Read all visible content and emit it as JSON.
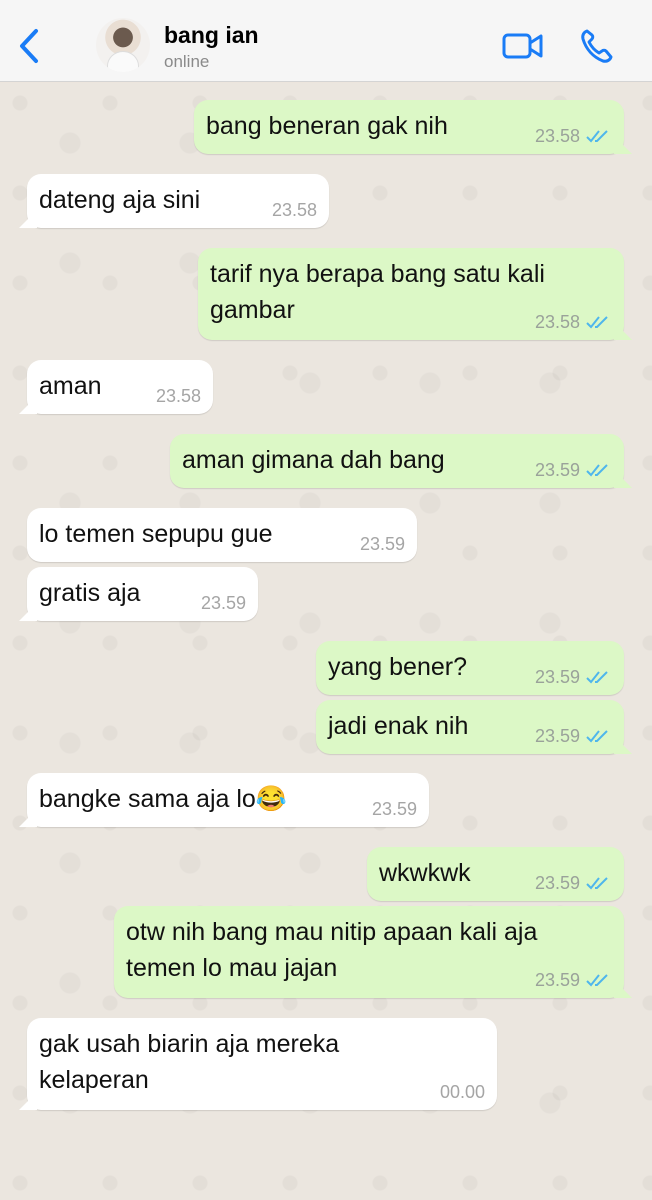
{
  "header": {
    "contact_name": "bang ian",
    "status": "online"
  },
  "colors": {
    "accent": "#1a7cf6",
    "outgoing_bubble": "#dcf8c6",
    "incoming_bubble": "#ffffff",
    "read_ticks": "#4fb6ec"
  },
  "icons": {
    "back": "chevron-left-icon",
    "video": "video-camera-icon",
    "call": "phone-icon",
    "ticks": "double-check-icon"
  },
  "messages": [
    {
      "dir": "out",
      "text": "bang beneran gak nih",
      "time": "23.58",
      "read": true
    },
    {
      "dir": "in",
      "text": "dateng aja sini",
      "time": "23.58"
    },
    {
      "dir": "out",
      "text": "tarif nya berapa bang satu kali\ngambar",
      "time": "23.58",
      "read": true
    },
    {
      "dir": "in",
      "text": "aman",
      "time": "23.58"
    },
    {
      "dir": "out",
      "text": "aman gimana dah bang",
      "time": "23.59",
      "read": true
    },
    {
      "dir": "in",
      "text": "lo temen sepupu gue",
      "time": "23.59"
    },
    {
      "dir": "in",
      "text": "gratis aja",
      "time": "23.59"
    },
    {
      "dir": "out",
      "text": "yang bener?",
      "time": "23.59",
      "read": true
    },
    {
      "dir": "out",
      "text": "jadi enak nih",
      "time": "23.59",
      "read": true
    },
    {
      "dir": "in",
      "text": "bangke sama aja lo😂",
      "time": "23.59"
    },
    {
      "dir": "out",
      "text": "wkwkwk",
      "time": "23.59",
      "read": true
    },
    {
      "dir": "out",
      "text": "otw nih bang mau nitip apaan kali aja\ntemen lo mau jajan",
      "time": "23.59",
      "read": true
    },
    {
      "dir": "in",
      "text": "gak usah biarin aja mereka\nkelaperan",
      "time": "00.00"
    }
  ]
}
